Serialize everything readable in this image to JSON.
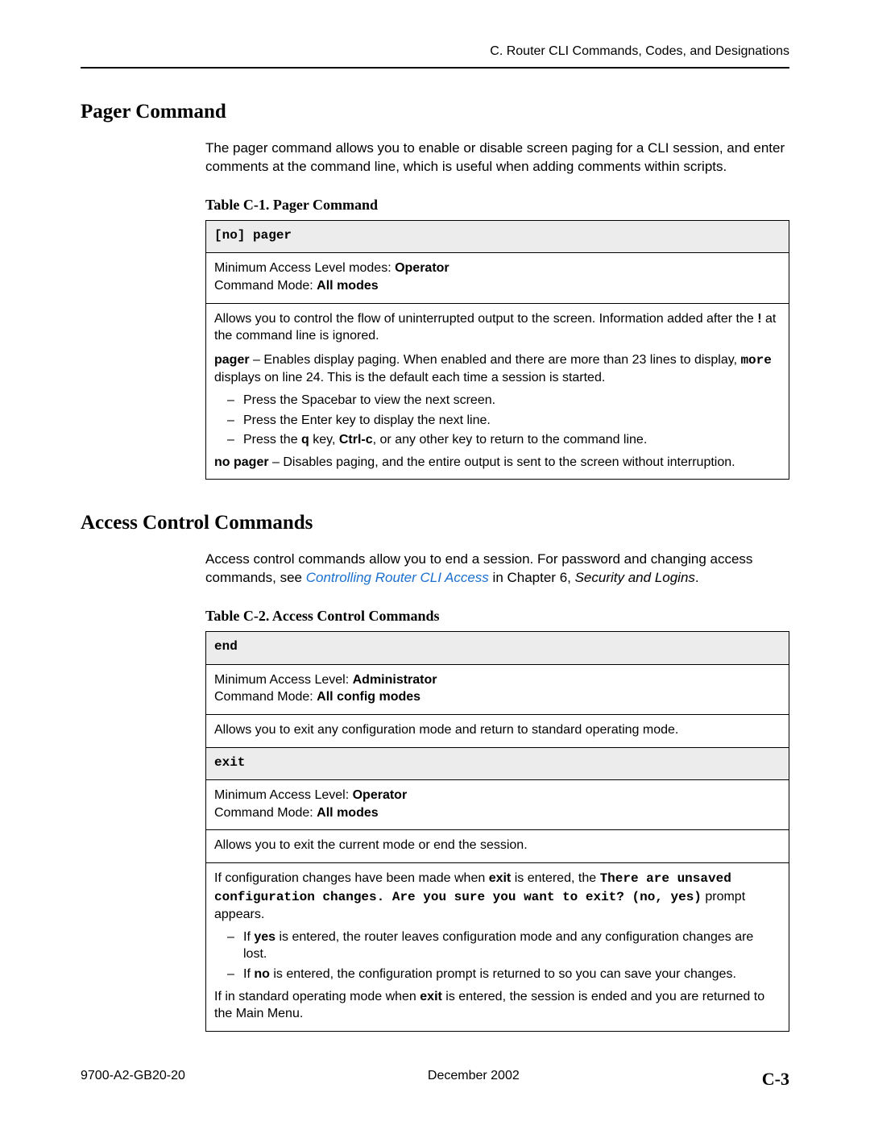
{
  "header": {
    "breadcrumb": "C. Router CLI Commands, Codes, and Designations"
  },
  "sec1": {
    "title": "Pager Command",
    "intro": "The pager command allows you to enable or disable screen paging for a CLI session, and enter comments at the command line, which is useful when adding comments within scripts.",
    "table_caption": "Table C-1.    Pager Command",
    "cmd_header": "[no] pager",
    "meta_min_label": "Minimum Access Level modes: ",
    "meta_min_value": "Operator",
    "meta_mode_label": "Command Mode: ",
    "meta_mode_value": "All modes",
    "desc_intro_a": "Allows you to control the flow of uninterrupted output to the screen. Information added after the ",
    "desc_intro_bang": "!",
    "desc_intro_b": " at the command line is ignored.",
    "pager_label": "pager",
    "pager_desc_a": " – Enables display paging. When enabled and there are more than 23 lines to display, ",
    "pager_more": "more",
    "pager_desc_b": " displays on line 24. This is the default each time a session is started.",
    "li1": "Press the Spacebar to view the next screen.",
    "li2": "Press the Enter key to display the next line.",
    "li3a": "Press the ",
    "li3_q": "q",
    "li3b": " key, ",
    "li3_ctrlc": "Ctrl-c",
    "li3c": ", or any other key to return to the command line.",
    "nopager_label": "no pager",
    "nopager_desc": " – Disables paging, and the entire output is sent to the screen without interruption."
  },
  "sec2": {
    "title": "Access Control Commands",
    "intro_a": "Access control commands allow you to end a session. For password and changing access commands, see ",
    "intro_link": "Controlling Router CLI Access",
    "intro_b": " in Chapter 6, ",
    "intro_ital": "Security and Logins",
    "intro_c": ".",
    "table_caption": "Table C-2.    Access Control Commands",
    "end_header": "end",
    "end_min_label": "Minimum Access Level: ",
    "end_min_value": "Administrator",
    "end_mode_label": "Command Mode: ",
    "end_mode_value": "All config modes",
    "end_desc": "Allows you to exit any configuration mode and return to standard operating mode.",
    "exit_header": "exit",
    "exit_min_label": "Minimum Access Level: ",
    "exit_min_value": "Operator",
    "exit_mode_label": "Command Mode: ",
    "exit_mode_value": "All modes",
    "exit_desc1": "Allows you to exit the current mode or end the session.",
    "exit_p2a": "If configuration changes have been made when ",
    "exit_p2_exit": "exit",
    "exit_p2b": " is entered, the ",
    "exit_prompt": "There are unsaved configuration changes. Are you sure you want to exit? (no, yes)",
    "exit_p2c": " prompt appears.",
    "exit_li1a": "If ",
    "exit_li1_yes": "yes",
    "exit_li1b": " is entered, the router leaves configuration mode and any configuration changes are lost.",
    "exit_li2a": "If ",
    "exit_li2_no": "no",
    "exit_li2b": " is entered, the configuration prompt is returned to so you can save your changes.",
    "exit_p3a": "If in standard operating mode when ",
    "exit_p3_exit": "exit",
    "exit_p3b": " is entered, the session is ended and you are returned to the Main Menu."
  },
  "footer": {
    "doc": "9700-A2-GB20-20",
    "date": "December 2002",
    "page": "C-3"
  }
}
